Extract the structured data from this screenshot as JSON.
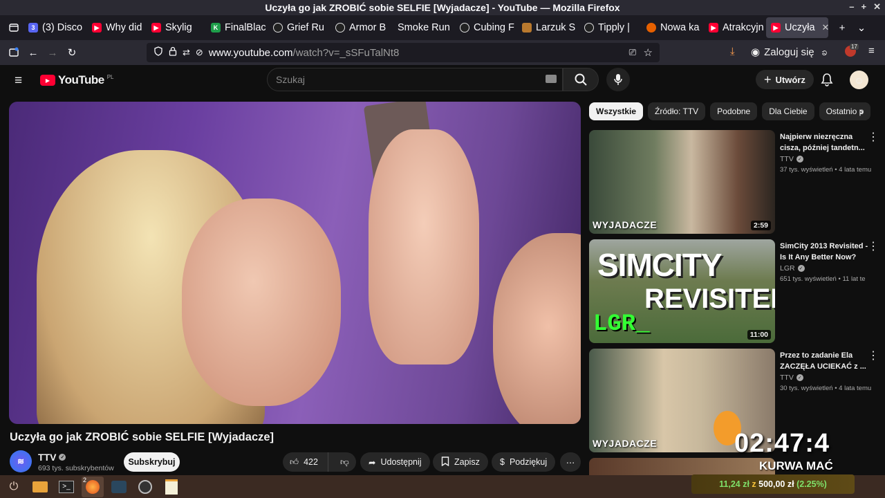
{
  "window": {
    "title": "Uczyła go jak ZROBIĆ sobie SELFIE [Wyjadacze] - YouTube — Mozilla Firefox",
    "controls": [
      "–",
      "+",
      "✕"
    ]
  },
  "tabs": [
    {
      "label": "(3) Disco",
      "icon": "discord-icon",
      "color": "#5865f2"
    },
    {
      "label": "Why did",
      "icon": "youtube-icon",
      "color": "#ff0033"
    },
    {
      "label": "Skylig",
      "icon": "youtube-audio-icon",
      "color": "#ff0033"
    },
    {
      "label": "FinalBlac",
      "icon": "finalblade-icon",
      "color": "#1e9e4a"
    },
    {
      "label": "Grief Ru",
      "icon": "circle-logo-icon",
      "color": "#222222"
    },
    {
      "label": "Armor B",
      "icon": "circle-logo-icon",
      "color": "#222222"
    },
    {
      "label": "Smoke Run",
      "icon": "none",
      "color": "#1c1b22"
    },
    {
      "label": "Cubing F",
      "icon": "circle-logo-icon",
      "color": "#222222"
    },
    {
      "label": "Larzuk S",
      "icon": "larzuk-icon",
      "color": "#b9792e"
    },
    {
      "label": "Tipply |",
      "icon": "circle-logo-icon",
      "color": "#222222"
    },
    {
      "label": "Nowa ka",
      "icon": "firefox-icon",
      "color": "#e66000"
    },
    {
      "label": "Atrakcyjn",
      "icon": "youtube-icon",
      "color": "#ff0033"
    },
    {
      "label": "Uczyła",
      "icon": "youtube-icon",
      "color": "#ff0033",
      "active": true
    }
  ],
  "navbar": {
    "url_host": "www.youtube.com",
    "url_path": "/watch?v=_sSFuTalNt8",
    "login_label": "Zaloguj się",
    "extension_badge": "17"
  },
  "yt": {
    "logo_text": "YouTube",
    "region": "PL",
    "search_placeholder": "Szukaj",
    "create_label": "Utwórz"
  },
  "video": {
    "title": "Uczyła go jak ZROBIĆ sobie SELFIE [Wyjadacze]",
    "channel": "TTV",
    "subscribers": "693 tys. subskrybentów",
    "subscribe_label": "Subskrybuj",
    "likes": "422",
    "share_label": "Udostępnij",
    "save_label": "Zapisz",
    "thanks_label": "Podziękuj"
  },
  "chips": [
    "Wszystkie",
    "Źródło: TTV",
    "Podobne",
    "Dla Ciebie",
    "Ostatnio p"
  ],
  "recommendations": [
    {
      "title": "Najpierw niezręczna cisza, później tandetn...",
      "channel": "TTV",
      "meta": "37 tys. wyświetleń • 4 lata temu",
      "duration": "2:59",
      "brand": "WYJADACZE"
    },
    {
      "title": "SimCity 2013 Revisited - Is It Any Better Now?",
      "channel": "LGR",
      "meta": "651 tys. wyświetleń • 11 lat te",
      "duration": "11:00",
      "brand": "SIMCITY REVISITED LGR_"
    },
    {
      "title": "Przez to zadanie Ela ZACZĘŁA UCIEKAĆ z ...",
      "channel": "TTV",
      "meta": "30 tys. wyświetleń • 4 lata temu",
      "duration": "",
      "brand": "WYJADACZE"
    }
  ],
  "overlay": {
    "clock": "02:47:4",
    "label": "KURWA MAĆ"
  },
  "wallet": {
    "amount": "11,24 zł",
    "sep": "z",
    "goal": "500,00 zł",
    "percent": "(2.25%)"
  },
  "taskbar": {
    "badge": "2"
  }
}
